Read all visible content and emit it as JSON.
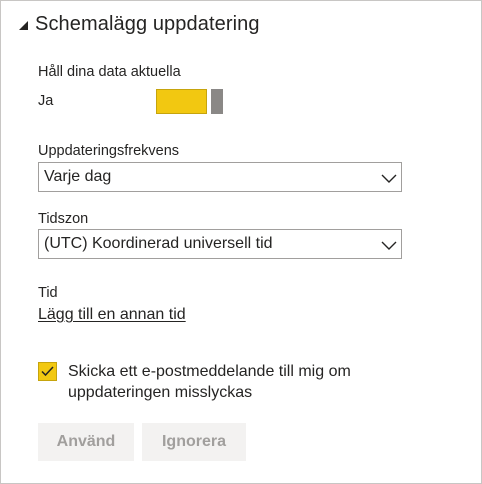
{
  "section": {
    "title": "Schemalägg uppdatering",
    "collapse_icon": "caret-down-icon"
  },
  "keep_updated": {
    "label": "Håll dina data aktuella",
    "toggle_label": "Ja",
    "toggle_on": true
  },
  "frequency": {
    "label": "Uppdateringsfrekvens",
    "value": "Varje dag"
  },
  "timezone": {
    "label": "Tidszon",
    "value": "(UTC) Koordinerad universell tid"
  },
  "time": {
    "label": "Tid",
    "add_link": "Lägg till en annan tid"
  },
  "email_notify": {
    "checked": true,
    "label": "Skicka ett e-postmeddelande till mig om uppdateringen misslyckas"
  },
  "buttons": {
    "apply": "Använd",
    "discard": "Ignorera"
  },
  "colors": {
    "accent": "#f2c811",
    "toggle_knob": "#8a8886",
    "disabled_button_bg": "#f3f2f1",
    "disabled_button_text": "#a19f9d",
    "border": "#a19f9d"
  }
}
